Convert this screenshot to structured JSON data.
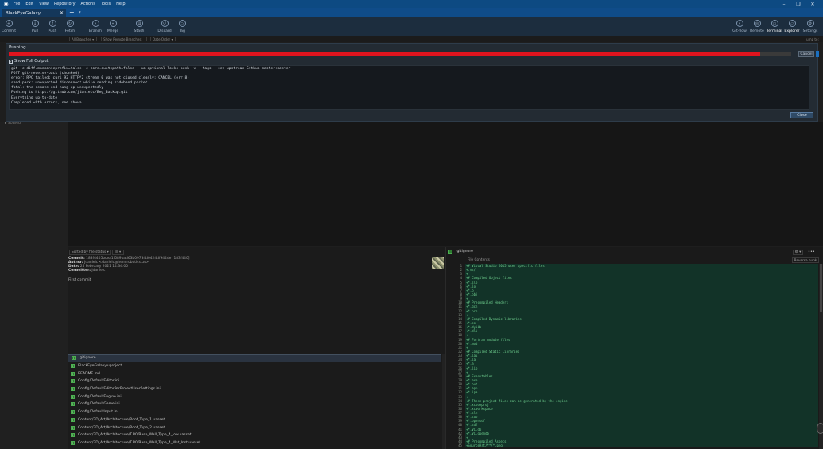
{
  "window": {
    "menu": [
      "File",
      "Edit",
      "View",
      "Repository",
      "Actions",
      "Tools",
      "Help"
    ],
    "controls": [
      "–",
      "❐",
      "✕"
    ]
  },
  "tabs": {
    "repo_name": "BlackEyeGalaxy",
    "close": "✕",
    "add": "+",
    "dropdown": "▾"
  },
  "toolbar": {
    "left": [
      {
        "label": "Commit",
        "icon": "commit-icon",
        "glyph": "+"
      },
      {
        "label": "Pull",
        "icon": "pull-icon",
        "glyph": "↓"
      },
      {
        "label": "Push",
        "icon": "push-icon",
        "glyph": "↑"
      },
      {
        "label": "Fetch",
        "icon": "fetch-icon",
        "glyph": "↻"
      },
      {
        "label": "Branch",
        "icon": "branch-icon",
        "glyph": "⑂"
      },
      {
        "label": "Merge",
        "icon": "merge-icon",
        "glyph": "⑃"
      },
      {
        "label": "Stash",
        "icon": "stash-icon",
        "glyph": "▤"
      },
      {
        "label": "Discard",
        "icon": "discard-icon",
        "glyph": "↺"
      },
      {
        "label": "Tag",
        "icon": "tag-icon",
        "glyph": "◇"
      }
    ],
    "right": [
      {
        "label": "Git-flow",
        "icon": "gitflow-icon",
        "glyph": "⑂"
      },
      {
        "label": "Remote",
        "icon": "remote-icon",
        "glyph": "◎"
      },
      {
        "label": "Terminal",
        "icon": "terminal-icon",
        "glyph": "▭"
      },
      {
        "label": "Explorer",
        "icon": "explorer-icon",
        "glyph": "▱"
      },
      {
        "label": "Settings",
        "icon": "settings-icon",
        "glyph": "⚙"
      }
    ]
  },
  "filters": {
    "branches": "All Branches",
    "remote": "Show Remote Branches",
    "order": "Date Order",
    "jump": "Jump to:"
  },
  "push_dialog": {
    "title": "Pushing",
    "progress_percent": 96,
    "progress_color": "#e0141e",
    "cancel_label": "Cancel",
    "show_full_output_label": "Show Full Output",
    "show_full_output_checked": true,
    "output_lines": [
      "git -c diff.mnemonicprefix=false -c core.quotepath=false --no-optional-locks push -v --tags --set-upstream Github master:master",
      "POST git-receive-pack (chunked)",
      "error: RPC failed; curl 92 HTTP/2 stream 0 was not closed cleanly: CANCEL (err 8)",
      "send-pack: unexpected disconnect while reading sideband packet",
      "fatal: the remote end hung up unexpectedly",
      "Pushing to https://github.com/jdanielc/Beg_Backup.git",
      "Everything up-to-date",
      "Completed with errors, see above."
    ],
    "close_label": "Close"
  },
  "sidebar": {
    "item": "▸ SUBMO"
  },
  "details": {
    "sort_label": "Sorted by file status",
    "sort_caret": "▾",
    "view_label": "☰ ▾",
    "commit_label": "Commit:",
    "commit_value": "183f4405bcea1f589bad63b09734d0424df944de [183f440]",
    "author_label": "Author:",
    "author_value": "jdanielc <danielc@hemirobotics.us>",
    "date_label": "Date:",
    "date_value": "25 February 2021 14:34:00",
    "committer_label": "Committer:",
    "committer_value": "jdanielc",
    "message": "First commit",
    "files": [
      ".gitignore",
      "BlackEyeGalaxy.uproject",
      "README.md",
      "Config/DefaultEditor.ini",
      "Config/DefaultEditorPerProjectUserSettings.ini",
      "Config/DefaultEngine.ini",
      "Config/DefaultGame.ini",
      "Config/DefaultInput.ini",
      "Content/3D_Art/Architecture/Roof_Type_1.uasset",
      "Content/3D_Art/Architecture/Roof_Type_2.uasset",
      "Content/3D_Art/Architecture/T.B0/Base_Wall_Type_4_low.uasset",
      "Content/3D_Art/Architecture/T.B0/Base_Wall_Type_4_Mat_Inst.uasset"
    ],
    "status_glyph": "+"
  },
  "diff": {
    "file": ".gitignore",
    "contents_label": "File Contents",
    "reverse_hunk_label": "Reverse hunk",
    "gear_label": "⚙ ▾",
    "more_label": "•••",
    "lines": [
      "+# Visual Studio 2015 user specific files",
      "+.vs/",
      "+",
      "+# Compiled Object files",
      "+*.slo",
      "+*.lo",
      "+*.o",
      "+*.obj",
      "+",
      "+# Precompiled Headers",
      "+*.gch",
      "+*.pch",
      "+",
      "+# Compiled Dynamic libraries",
      "+*.so",
      "+*.dylib",
      "+*.dll",
      "+",
      "+# Fortran module files",
      "+*.mod",
      "+",
      "+# Compiled Static libraries",
      "+*.lai",
      "+*.la",
      "+*.a",
      "+*.lib",
      "+",
      "+# Executables",
      "+*.exe",
      "+*.out",
      "+*.app",
      "+*.ipa",
      "+",
      "+# These project files can be generated by the engine",
      "+*.xcodeproj",
      "+*.xcworkspace",
      "+*.sln",
      "+*.suo",
      "+*.opensdf",
      "+*.sdf",
      "+*.VC.db",
      "+*.VC.opendb",
      "+",
      "+# Precompiled Assets",
      "+SourceArt/**/*.png"
    ]
  }
}
